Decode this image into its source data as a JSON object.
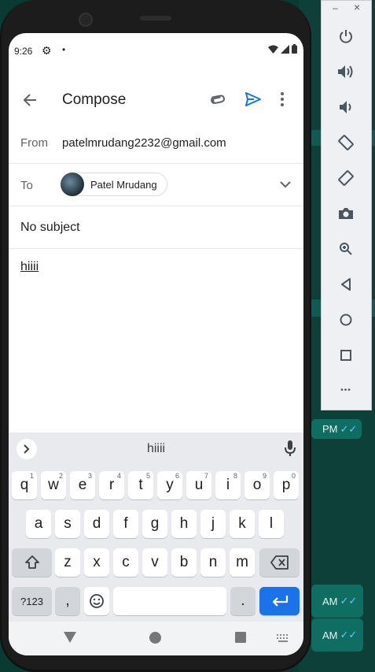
{
  "status_bar": {
    "time": "9:26",
    "icons": [
      "gear-icon",
      "dot-icon",
      "wifi-icon",
      "signal-icon",
      "battery-icon"
    ]
  },
  "app_bar": {
    "title": "Compose"
  },
  "compose": {
    "from_label": "From",
    "from_value": "patelmrudang2232@gmail.com",
    "to_label": "To",
    "to_chip": "Patel Mrudang",
    "subject": "No subject",
    "body": "hiiii"
  },
  "keyboard": {
    "suggestion": "hiiii",
    "row1": [
      {
        "k": "q",
        "n": "1"
      },
      {
        "k": "w",
        "n": "2"
      },
      {
        "k": "e",
        "n": "3"
      },
      {
        "k": "r",
        "n": "4"
      },
      {
        "k": "t",
        "n": "5"
      },
      {
        "k": "y",
        "n": "6"
      },
      {
        "k": "u",
        "n": "7"
      },
      {
        "k": "i",
        "n": "8"
      },
      {
        "k": "o",
        "n": "9"
      },
      {
        "k": "p",
        "n": "0"
      }
    ],
    "row2": [
      "a",
      "s",
      "d",
      "f",
      "g",
      "h",
      "j",
      "k",
      "l"
    ],
    "row3": [
      "z",
      "x",
      "c",
      "v",
      "b",
      "n",
      "m"
    ],
    "symbols": "?123",
    "comma": ",",
    "period": "."
  },
  "emulator_panel": {
    "minimize": "–",
    "close": "×",
    "more": "•••"
  },
  "background_chat": {
    "times": [
      "PM",
      "AM",
      "AM"
    ]
  },
  "colors": {
    "accent": "#1a73e8",
    "keyboard_bg": "#e8eaed",
    "chat_bg": "#0d4038"
  }
}
